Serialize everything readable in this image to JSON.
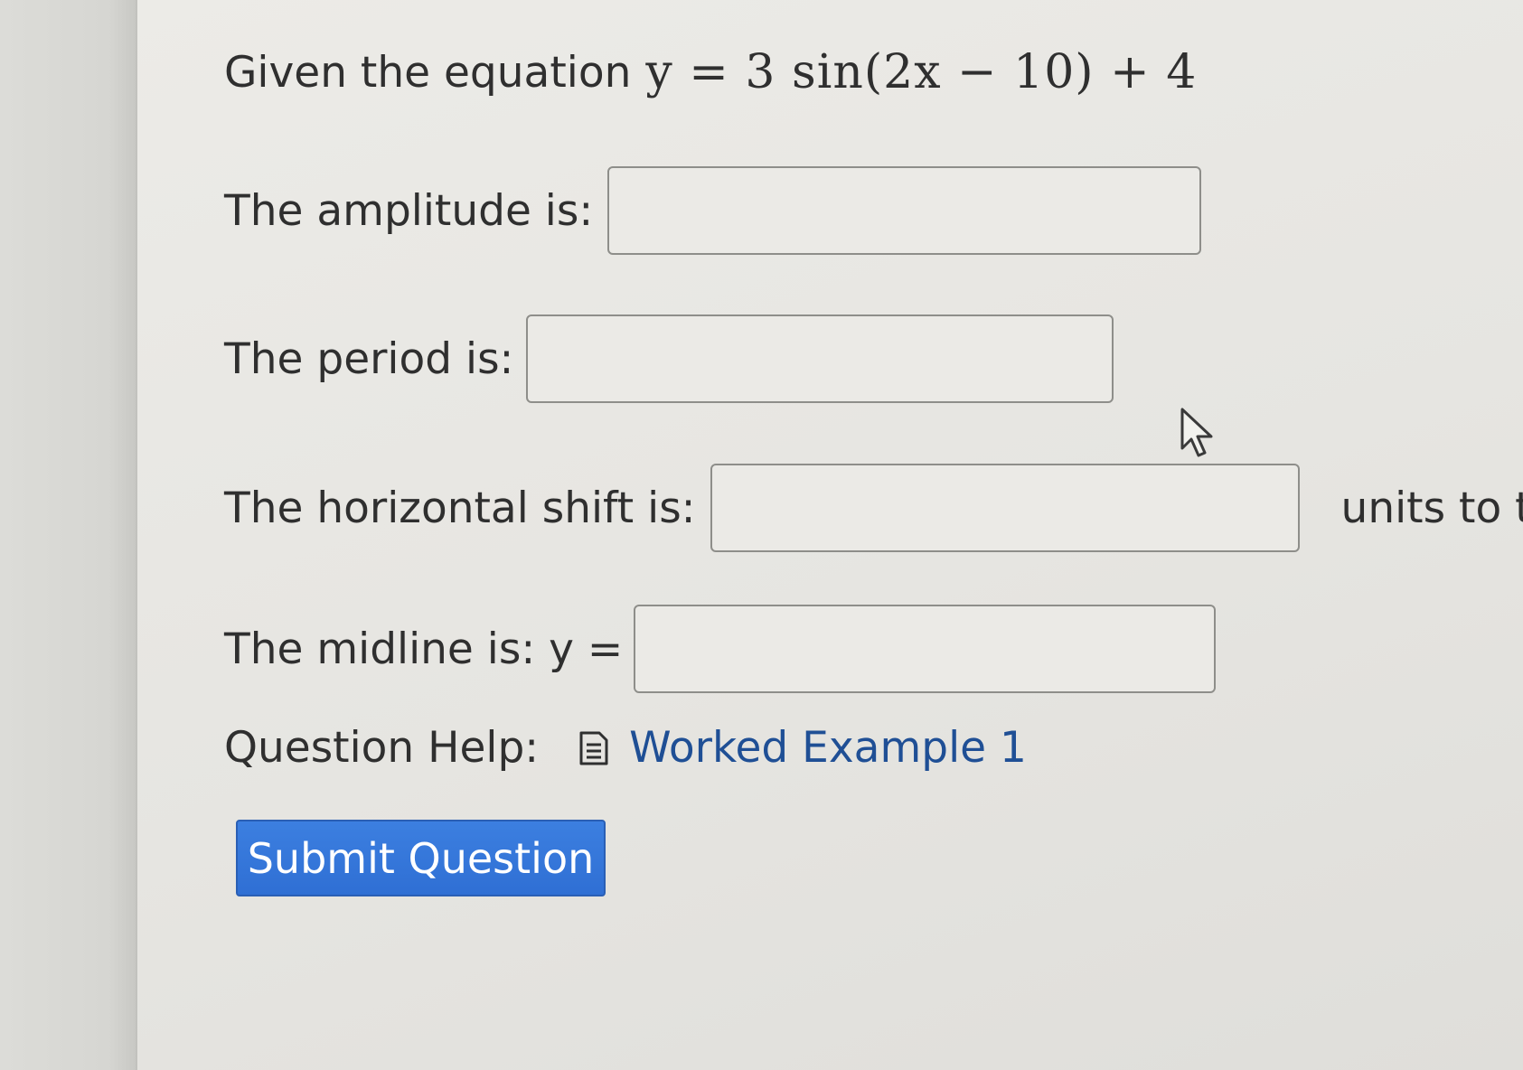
{
  "question": {
    "prefix": "Given the equation",
    "equation": "y = 3 sin(2x − 10) + 4"
  },
  "fields": {
    "amplitude_label": "The amplitude is:",
    "amplitude_value": "",
    "period_label": "The period is:",
    "period_value": "",
    "horizontal_shift_label": "The horizontal shift is:",
    "horizontal_shift_value": "",
    "horizontal_shift_suffix": "units to the",
    "midline_label": "The midline is: y =",
    "midline_value": ""
  },
  "help": {
    "label": "Question Help:",
    "link_label": "Worked Example 1",
    "link_icon": "document-icon"
  },
  "submit": {
    "label": "Submit Question"
  },
  "colors": {
    "link": "#1f4f95",
    "button": "#2f6fd4",
    "text": "#2f2f2f"
  }
}
